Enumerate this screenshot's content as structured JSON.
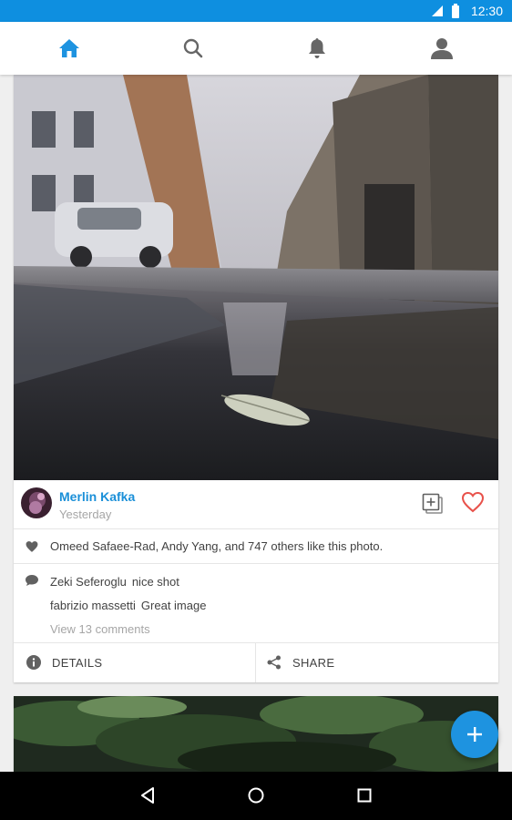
{
  "status_bar": {
    "time": "12:30"
  },
  "top_nav": {
    "items": [
      "home-icon",
      "search-icon",
      "bell-icon",
      "profile-icon"
    ],
    "active": "home-icon"
  },
  "posts": [
    {
      "author": "Merlin Kafka",
      "time": "Yesterday",
      "likes_text": "Omeed Safaee-Rad, Andy Yang, and 747 others like this photo.",
      "comments": [
        {
          "user": "Zeki Seferoglu",
          "text": "nice shot"
        },
        {
          "user": "fabrizio massetti",
          "text": "Great image"
        }
      ],
      "view_comments": "View 13 comments",
      "details_label": "DETAILS",
      "share_label": "SHARE"
    }
  ],
  "colors": {
    "accent": "#1e93e0",
    "status_bar": "#0e8fe0",
    "like": "#e8514a",
    "link": "#1a8fd8"
  }
}
